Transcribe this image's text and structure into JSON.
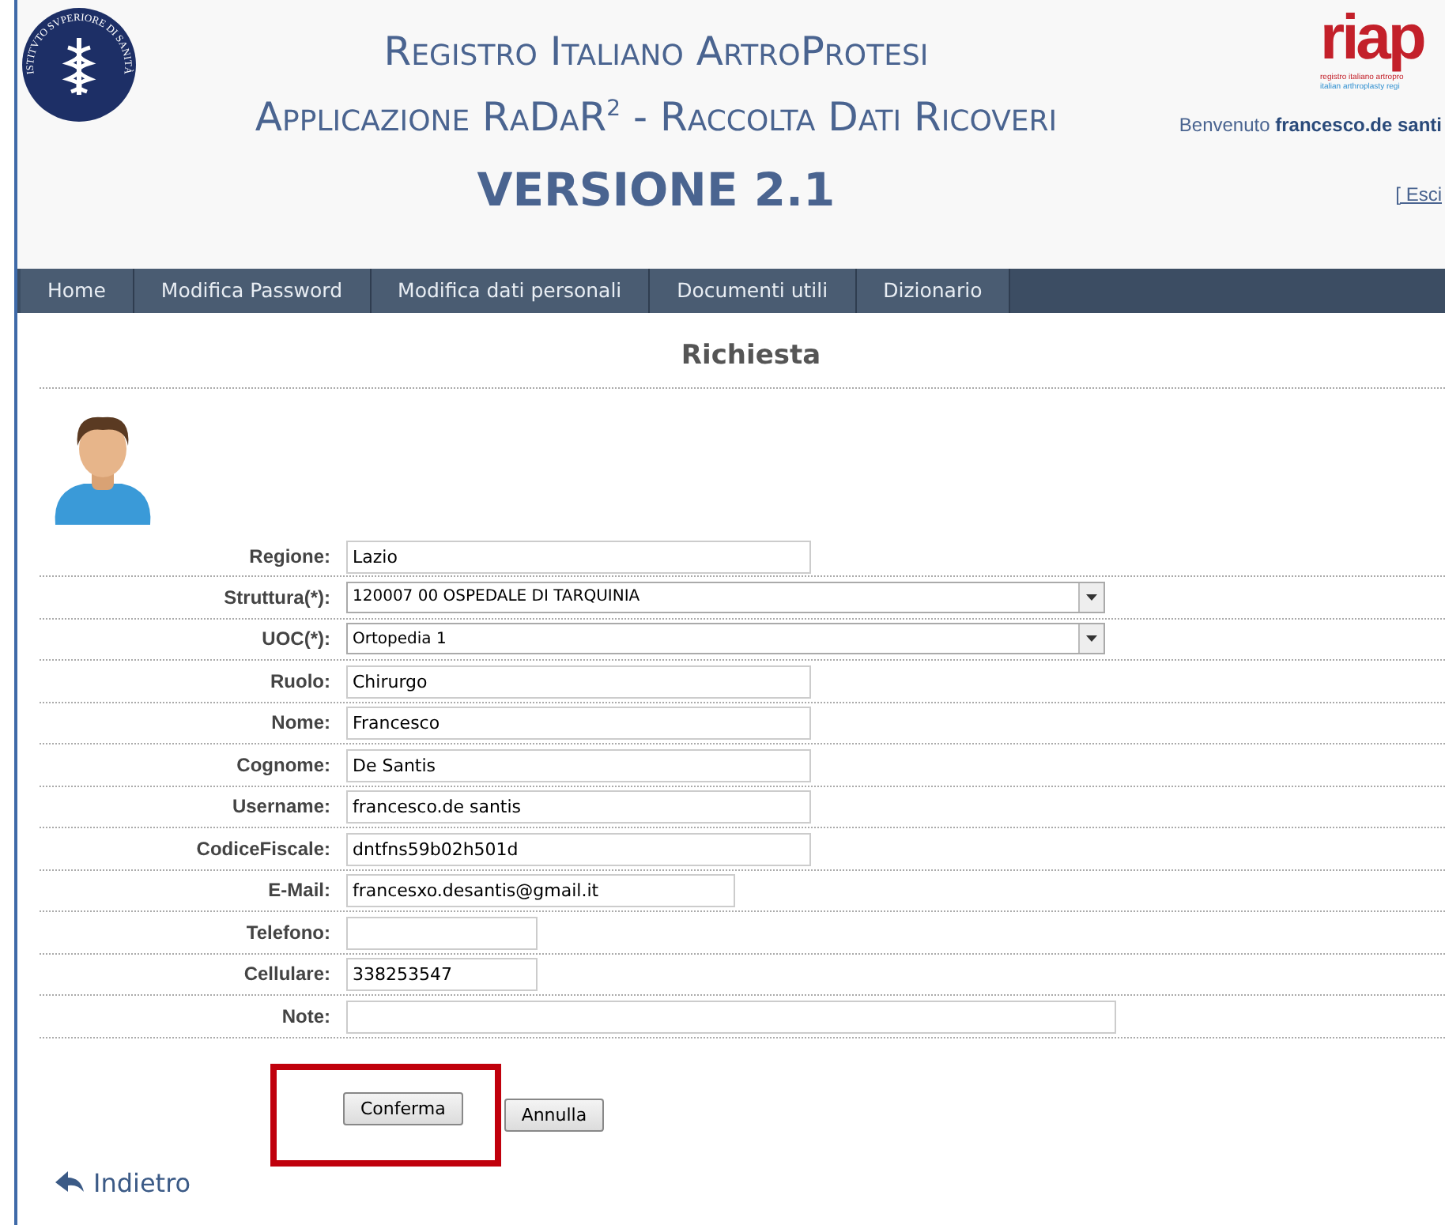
{
  "header": {
    "seal_text": "ISTITVTO SVPERIORE DI SANITÀ",
    "title_lines": [
      "Registro Italiano ArtroProtesi",
      "Applicazione RaDaR$^{2}$ - Raccolta Dati Ricoveri"
    ],
    "version": "VERSIONE 2.1",
    "brand": {
      "name": "riap",
      "lines": [
        "registro italiano artropro",
        "italian arthroplasty regi"
      ]
    },
    "welcome": "Benvenuto **francesco.de santi**",
    "logout": "[ Esci"
  },
  "nav": [
    {
      "label": "Home"
    },
    {
      "label": "Modifica Password"
    },
    {
      "label": "Modifica dati personali"
    },
    {
      "label": "Documenti utili"
    },
    {
      "label": "Dizionario"
    }
  ],
  "page_title": "Richiesta",
  "fields": [
    {
      "label": "Regione:",
      "kind": "text",
      "value": "Lazio"
    },
    {
      "label": "Struttura(*):",
      "kind": "select",
      "value": "120007 00 OSPEDALE DI TARQUINIA"
    },
    {
      "label": "UOC(*):",
      "kind": "select",
      "value": "Ortopedia 1"
    },
    {
      "label": "Ruolo:",
      "kind": "text",
      "value": "Chirurgo"
    },
    {
      "label": "Nome:",
      "kind": "text",
      "value": "Francesco"
    },
    {
      "label": "Cognome:",
      "kind": "text",
      "value": "De Santis"
    },
    {
      "label": "Username:",
      "kind": "text",
      "value": "francesco.de santis"
    },
    {
      "label": "CodiceFiscale:",
      "kind": "text",
      "value": "dntfns59b02h501d"
    },
    {
      "label": "E-Mail:",
      "kind": "text",
      "value": "francesxo.desantis@gmail.it"
    },
    {
      "label": "Telefono:",
      "kind": "text"
    },
    {
      "label": "Cellulare:",
      "kind": "text",
      "value": "338253547"
    },
    {
      "label": "Note:",
      "kind": "text"
    }
  ],
  "buttons": [
    {
      "label": "Conferma",
      "highlighted": true
    },
    {
      "label": "Annulla",
      "highlighted": false
    }
  ],
  "back_link": "Indietro"
}
